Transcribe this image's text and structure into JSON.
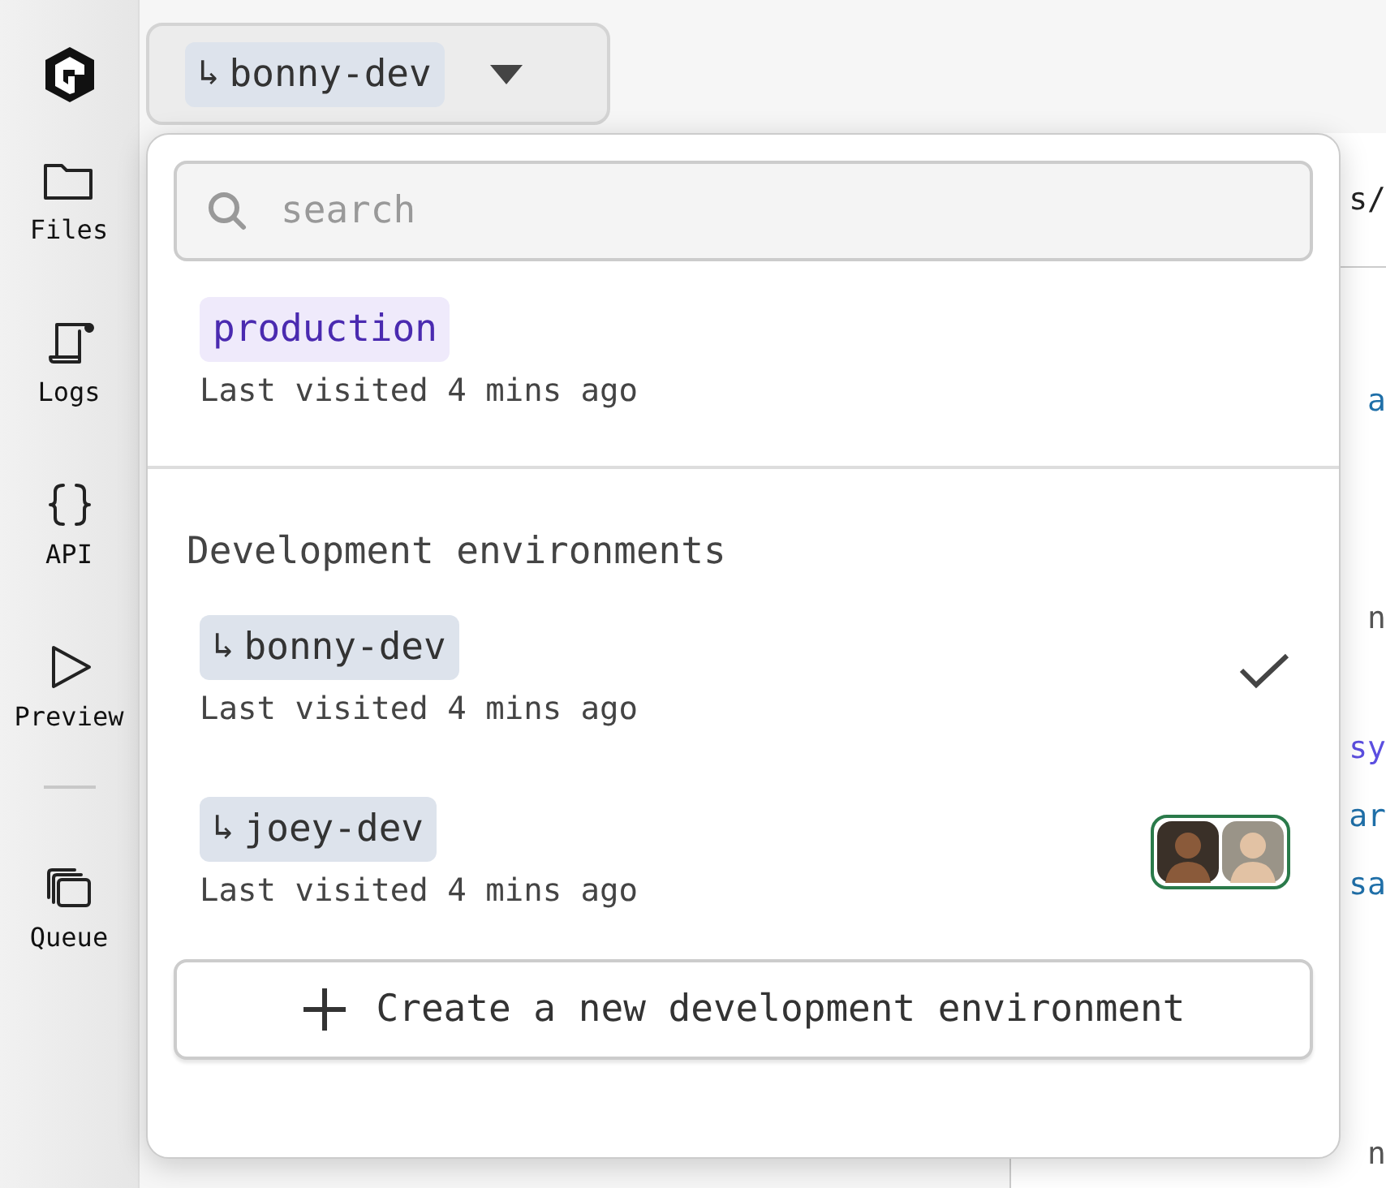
{
  "sidebar": {
    "items": [
      {
        "label": "Files",
        "selected": false
      },
      {
        "label": "Logs",
        "selected": false
      },
      {
        "label": "API",
        "selected": false
      },
      {
        "label": "Preview",
        "selected": false
      },
      {
        "label": "Queue",
        "selected": false
      }
    ]
  },
  "env_button": {
    "prefix": "↳",
    "label": "bonny-dev",
    "expanded": true
  },
  "editor": {
    "fragments": [
      {
        "text": "s/",
        "color": "#222222"
      },
      {
        "text": "a",
        "color": "#1f6fa8"
      },
      {
        "text": "n",
        "color": "#555555"
      },
      {
        "text": "sy",
        "color": "#5b4ee0"
      },
      {
        "text": "ar",
        "color": "#1f6fa8"
      },
      {
        "text": "sa",
        "color": "#1f6fa8"
      },
      {
        "text": "n",
        "color": "#555555"
      }
    ]
  },
  "dropdown": {
    "search": {
      "placeholder": "search"
    },
    "production": {
      "name": "production",
      "kind": "production",
      "visited": "Last visited 4 mins ago"
    },
    "section_title": "Development environments",
    "environments": [
      {
        "prefix": "↳",
        "name": "bonny-dev",
        "kind": "development",
        "visited": "Last visited 4 mins ago",
        "selected": true
      },
      {
        "prefix": "↳",
        "name": "joey-dev",
        "kind": "development",
        "visited": "Last visited 4 mins ago",
        "selected": false,
        "avatars": [
          {
            "kind": "person"
          },
          {
            "kind": "person"
          }
        ]
      }
    ],
    "create_button": {
      "label": "Create a new development environment"
    }
  }
}
